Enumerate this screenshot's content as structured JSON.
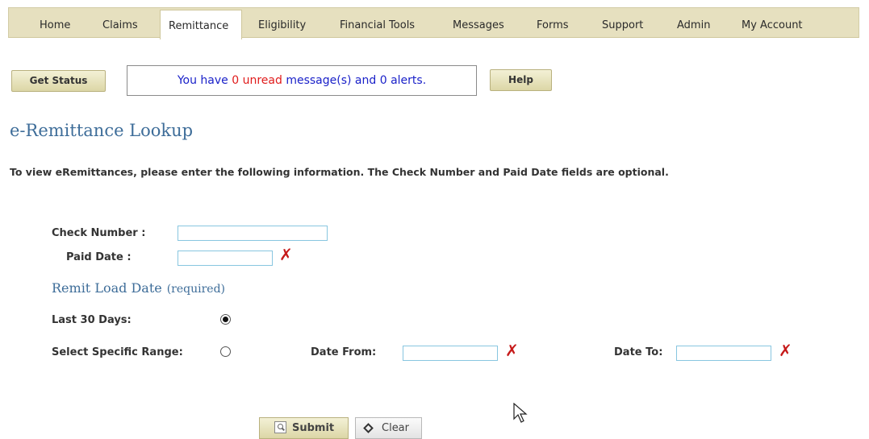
{
  "nav": {
    "items": [
      {
        "label": "Home"
      },
      {
        "label": "Claims"
      },
      {
        "label": "Remittance"
      },
      {
        "label": "Eligibility"
      },
      {
        "label": "Financial Tools"
      },
      {
        "label": "Messages"
      },
      {
        "label": "Forms"
      },
      {
        "label": "Support"
      },
      {
        "label": "Admin"
      },
      {
        "label": "My Account"
      }
    ],
    "active": "Remittance"
  },
  "toolbar": {
    "get_status_label": "Get Status",
    "help_label": "Help",
    "message": {
      "prefix": "You have",
      "unread_count": "0",
      "unread_word": "unread",
      "suffix": "message(s) and 0 alerts."
    }
  },
  "page": {
    "title": "e-Remittance Lookup",
    "instructions": "To view eRemittances, please enter the following information. The Check Number and Paid Date fields are optional."
  },
  "form": {
    "check_number_label": "Check Number :",
    "check_number_value": "",
    "paid_date_label": "Paid Date :",
    "paid_date_value": "",
    "remit_section_title": "Remit Load Date",
    "remit_section_required": "(required)",
    "last30_label": "Last 30 Days:",
    "specific_range_label": "Select Specific Range:",
    "date_from_label": "Date From:",
    "date_from_value": "",
    "date_to_label": "Date To:",
    "date_to_value": "",
    "selected_option": "Last 30 Days",
    "clear_mark": "✗",
    "submit_label": "Submit",
    "clear_label": "Clear"
  },
  "colors": {
    "nav_bg": "#e6e0bf",
    "heading_blue": "#3e6d99",
    "message_blue": "#1a21c9",
    "alert_red": "#e01b1b",
    "clear_mark_red": "#c61a1a",
    "input_border": "#88c6e0"
  },
  "icons": {
    "submit": "magnifier-icon",
    "clear": "diamond-icon",
    "date_clear": "red-x-icon",
    "pointer": "mouse-cursor-icon"
  }
}
